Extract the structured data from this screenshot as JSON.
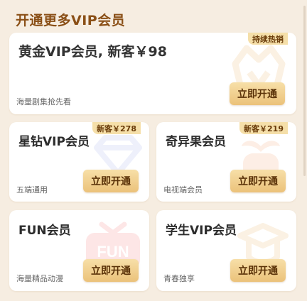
{
  "page": {
    "title": "开通更多VIP会员"
  },
  "cards": {
    "gold": {
      "name": "黄金VIP会员, 新客￥98",
      "tag": "持续热销",
      "desc": "海量剧集抢先看",
      "button": "立即开通",
      "icon": "crown-icon"
    },
    "star": {
      "name": "星钻VIP会员",
      "tag": "新客￥278",
      "desc": "五端通用",
      "button": "立即开通",
      "icon": "diamond-icon"
    },
    "qiyiguo": {
      "name": "奇异果会员",
      "tag": "新客￥219",
      "desc": "电视端会员",
      "button": "立即开通",
      "icon": "fruit-icon"
    },
    "fun": {
      "name": "FUN会员",
      "desc": "海量精品动漫",
      "button": "立即开通",
      "icon": "fun-tv-icon",
      "icon_text": "FUN"
    },
    "student": {
      "name": "学生VIP会员",
      "desc": "青春独享",
      "button": "立即开通",
      "icon": "graduation-cap-icon"
    }
  },
  "colors": {
    "background": "#f6ede1",
    "title": "#8a4f16",
    "button": "#ebc27a",
    "tag": "#f5dfa9"
  }
}
